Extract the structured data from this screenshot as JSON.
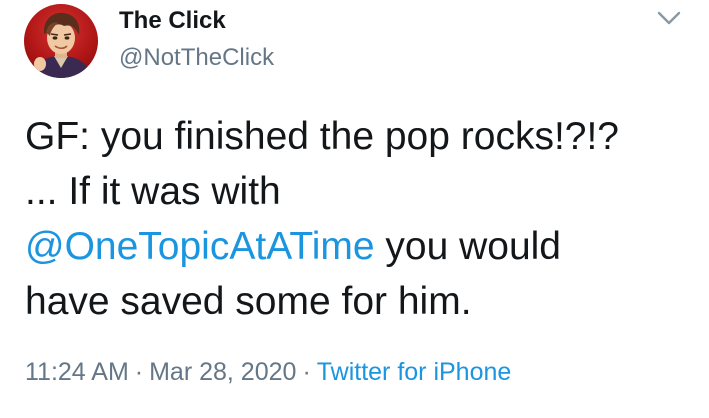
{
  "author": {
    "display_name": "The Click",
    "handle": "@NotTheClick",
    "avatar_icon": "illustrated-avatar"
  },
  "menu": {
    "icon": "chevron-down-icon"
  },
  "tweet": {
    "line1": "GF: you finished the pop rocks!?!?",
    "line2": "... If it was with",
    "mention": "@OneTopicAtATime",
    "line3_rest": " you would",
    "line4": "have saved some for him."
  },
  "meta": {
    "time": "11:24 AM",
    "separator": "·",
    "date": "Mar 28, 2020",
    "source": "Twitter for iPhone"
  },
  "colors": {
    "link": "#1b95e0",
    "secondary_text": "#657786",
    "primary_text": "#14171a",
    "avatar_background": "#c42020"
  }
}
